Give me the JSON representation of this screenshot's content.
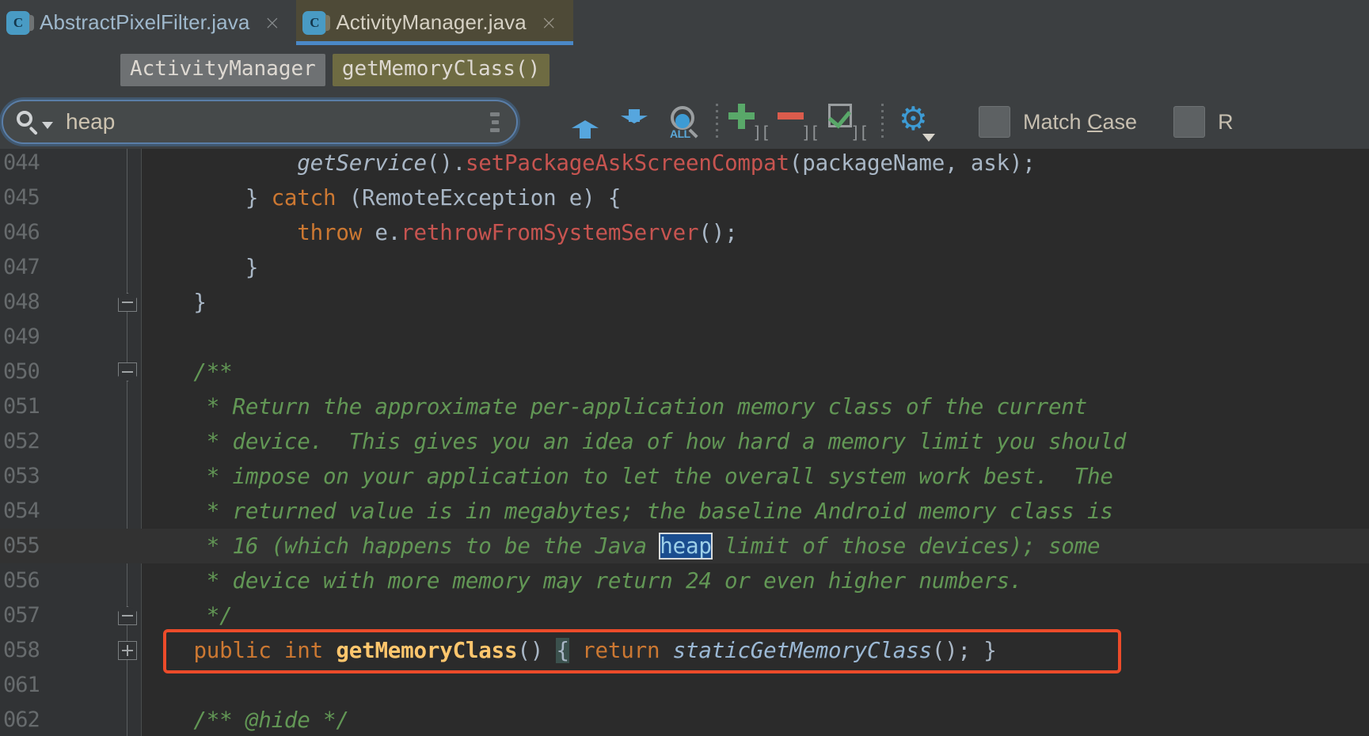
{
  "window": {
    "app": "IntelliJ IDEA Editor",
    "theme_accent": "#4a88c7",
    "editor_bg": "#2b2b2b",
    "chrome_bg": "#3c3f41"
  },
  "tabs": [
    {
      "label": "AbstractPixelFilter.java",
      "icon": "java-class-icon",
      "icon_letter": "C",
      "close": "×",
      "active": false
    },
    {
      "label": "ActivityManager.java",
      "icon": "java-class-icon",
      "icon_letter": "C",
      "close": "×",
      "active": true
    }
  ],
  "breadcrumb": {
    "class": "ActivityManager",
    "method": "getMemoryClass()"
  },
  "find_toolbar": {
    "search_value": "heap",
    "search_placeholder": "Search",
    "buttons": [
      {
        "name": "find-previous",
        "icon": "arrow-up-icon",
        "tooltip": "Previous Occurrence"
      },
      {
        "name": "find-next",
        "icon": "arrow-down-icon",
        "tooltip": "Next Occurrence"
      },
      {
        "name": "find-all",
        "icon": "find-all-icon",
        "label": "ALL",
        "tooltip": "Find All"
      },
      {
        "name": "add-selection-next",
        "icon": "plus-icon",
        "tooltip": "Select All Occurrences"
      },
      {
        "name": "remove-selection",
        "icon": "minus-icon",
        "tooltip": "Remove Occurrence"
      },
      {
        "name": "select-all-occurrences",
        "icon": "checkbox-check-icon",
        "tooltip": "Select All Occurrences"
      },
      {
        "name": "find-settings",
        "icon": "gear-icon",
        "tooltip": "Find Settings"
      }
    ],
    "checkboxes": [
      {
        "label_before": "Match ",
        "mnemonic": "C",
        "label_after": "ase",
        "checked": false
      },
      {
        "label_before": "R",
        "mnemonic": "",
        "label_after": "",
        "checked": false
      }
    ]
  },
  "editor": {
    "lines": [
      {
        "num": "044",
        "indent": 0,
        "highlight": false,
        "tokens": [
          {
            "text": "            ",
            "cls": "t-plain"
          },
          {
            "text": "getService",
            "cls": "t-ital"
          },
          {
            "text": "().",
            "cls": "t-plain"
          },
          {
            "text": "setPackageAskScreenCompat",
            "cls": "t-call"
          },
          {
            "text": "(packageName, ask);",
            "cls": "t-plain"
          }
        ]
      },
      {
        "num": "045",
        "indent": 0,
        "highlight": false,
        "tokens": [
          {
            "text": "        } ",
            "cls": "t-plain"
          },
          {
            "text": "catch",
            "cls": "t-kw"
          },
          {
            "text": " (RemoteException e) {",
            "cls": "t-plain"
          }
        ]
      },
      {
        "num": "046",
        "indent": 0,
        "highlight": false,
        "tokens": [
          {
            "text": "            ",
            "cls": "t-plain"
          },
          {
            "text": "throw",
            "cls": "t-kw"
          },
          {
            "text": " e.",
            "cls": "t-plain"
          },
          {
            "text": "rethrowFromSystemServer",
            "cls": "t-call"
          },
          {
            "text": "();",
            "cls": "t-plain"
          }
        ]
      },
      {
        "num": "047",
        "indent": 0,
        "highlight": false,
        "tokens": [
          {
            "text": "        }",
            "cls": "t-plain"
          }
        ]
      },
      {
        "num": "048",
        "indent": 0,
        "highlight": false,
        "fold": "up",
        "tokens": [
          {
            "text": "    }",
            "cls": "t-plain"
          }
        ]
      },
      {
        "num": "049",
        "indent": 0,
        "highlight": false,
        "tokens": []
      },
      {
        "num": "050",
        "indent": 0,
        "highlight": false,
        "fold": "dn",
        "tokens": [
          {
            "text": "    /**",
            "cls": "t-cmt"
          }
        ]
      },
      {
        "num": "051",
        "indent": 0,
        "highlight": false,
        "tokens": [
          {
            "text": "     * Return the approximate per-application memory class of the current",
            "cls": "t-cmt"
          }
        ]
      },
      {
        "num": "052",
        "indent": 0,
        "highlight": false,
        "tokens": [
          {
            "text": "     * device.  This gives you an idea of how hard a memory limit you should",
            "cls": "t-cmt"
          }
        ]
      },
      {
        "num": "053",
        "indent": 0,
        "highlight": false,
        "tokens": [
          {
            "text": "     * impose on your application to let the overall system work best.  The",
            "cls": "t-cmt"
          }
        ]
      },
      {
        "num": "054",
        "indent": 0,
        "highlight": false,
        "tokens": [
          {
            "text": "     * returned value is in megabytes; the baseline Android memory class is",
            "cls": "t-cmt"
          }
        ]
      },
      {
        "num": "055",
        "indent": 0,
        "highlight": true,
        "tokens": [
          {
            "text": "     * 16 (which happens to be the Java ",
            "cls": "t-cmt"
          },
          {
            "text": "heap",
            "cls": "t-match"
          },
          {
            "text": " limit of those devices); some",
            "cls": "t-cmt"
          }
        ]
      },
      {
        "num": "056",
        "indent": 0,
        "highlight": false,
        "tokens": [
          {
            "text": "     * device with more memory may return 24 or even higher numbers.",
            "cls": "t-cmt"
          }
        ]
      },
      {
        "num": "057",
        "indent": 0,
        "highlight": false,
        "fold": "up",
        "tokens": [
          {
            "text": "     */",
            "cls": "t-cmt"
          }
        ]
      },
      {
        "num": "058",
        "indent": 0,
        "highlight": false,
        "fold": "plus",
        "boxed": true,
        "tokens": [
          {
            "text": "    ",
            "cls": "t-plain"
          },
          {
            "text": "public int",
            "cls": "t-kw"
          },
          {
            "text": " ",
            "cls": "t-plain"
          },
          {
            "text": "getMemoryClass",
            "cls": "t-methb"
          },
          {
            "text": "()",
            "cls": "t-plain"
          },
          {
            "text": " ",
            "cls": "t-plain"
          },
          {
            "text": "{",
            "cls": "t-brace-hl"
          },
          {
            "text": " ",
            "cls": "t-plain"
          },
          {
            "text": "return",
            "cls": "t-kw"
          },
          {
            "text": " ",
            "cls": "t-plain"
          },
          {
            "text": "staticGetMemoryClass",
            "cls": "t-static"
          },
          {
            "text": "();",
            "cls": "t-plain"
          },
          {
            "text": " }",
            "cls": "t-plain"
          }
        ]
      },
      {
        "num": "061",
        "indent": 0,
        "highlight": false,
        "tokens": []
      },
      {
        "num": "062",
        "indent": 0,
        "highlight": false,
        "tokens": [
          {
            "text": "    /** @hide */",
            "cls": "t-cmt"
          }
        ]
      }
    ]
  }
}
